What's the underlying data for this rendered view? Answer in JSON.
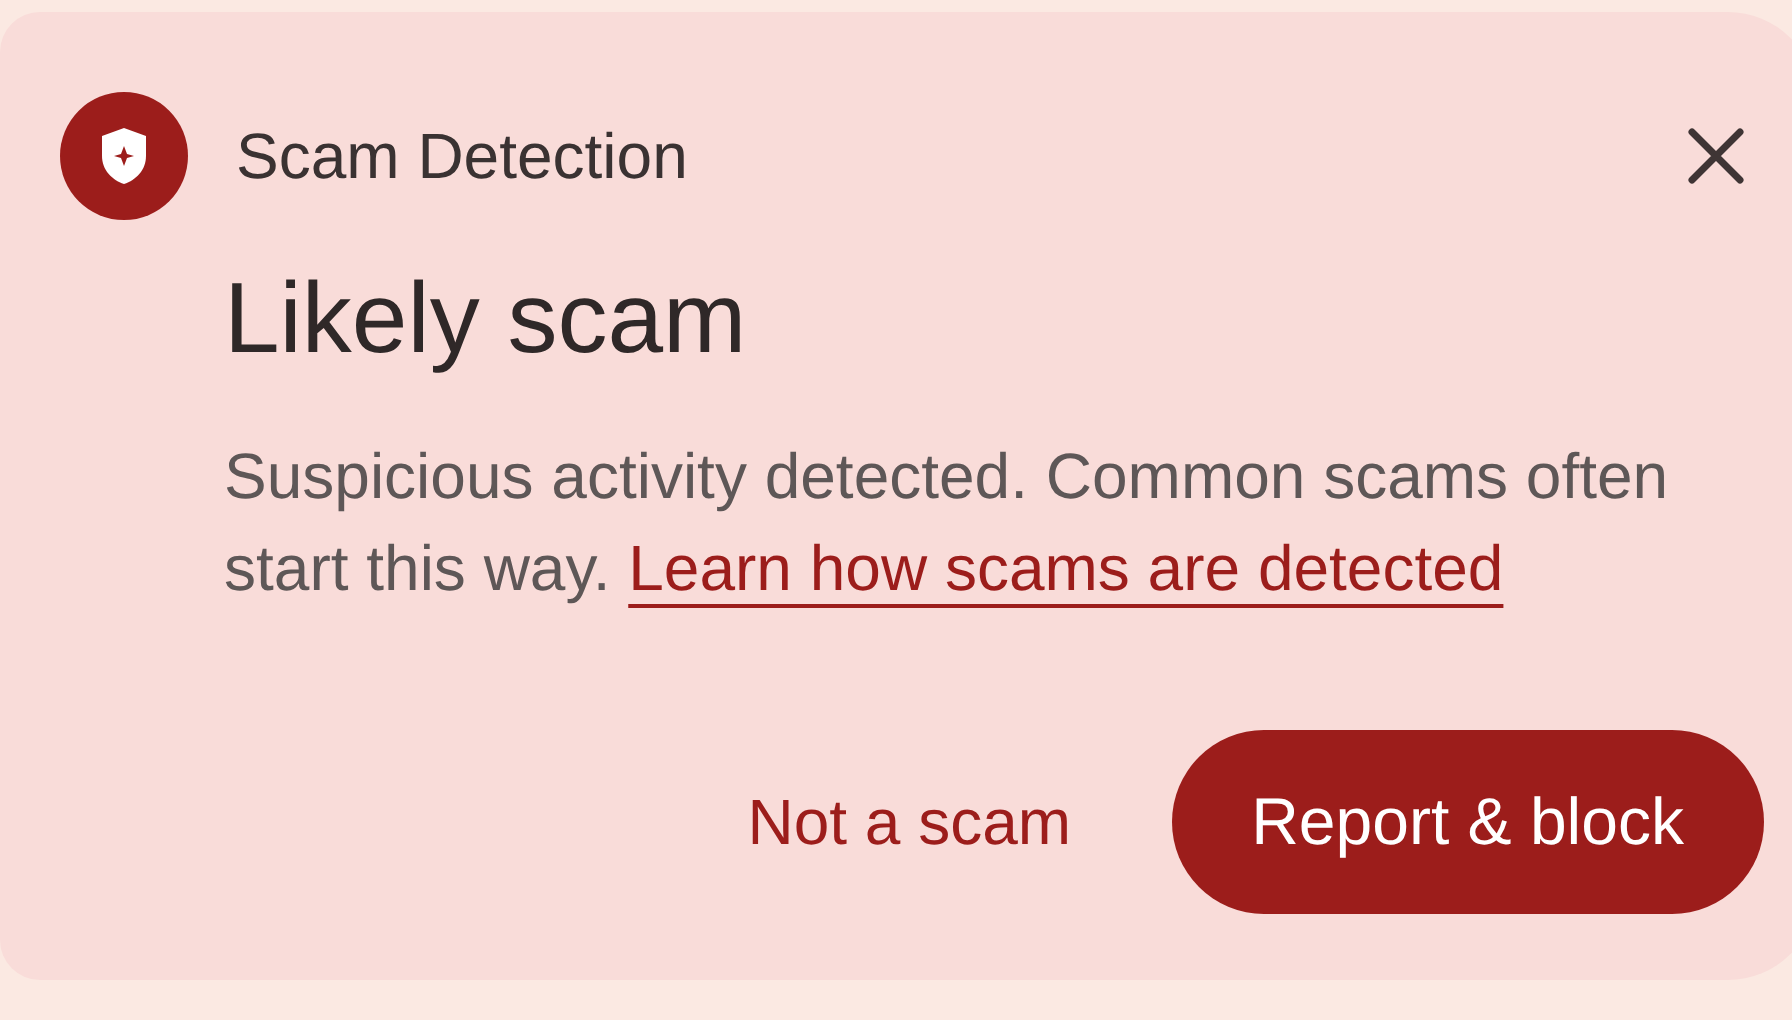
{
  "header": {
    "title": "Scam Detection"
  },
  "heading": "Likely scam",
  "body": {
    "text": "Suspicious activity detected. Common scams often start this way.",
    "link": "Learn how scams are detected"
  },
  "buttons": [
    {
      "label": "Not a scam",
      "kind": "text"
    },
    {
      "label": "Report & block",
      "kind": "filled"
    }
  ]
}
